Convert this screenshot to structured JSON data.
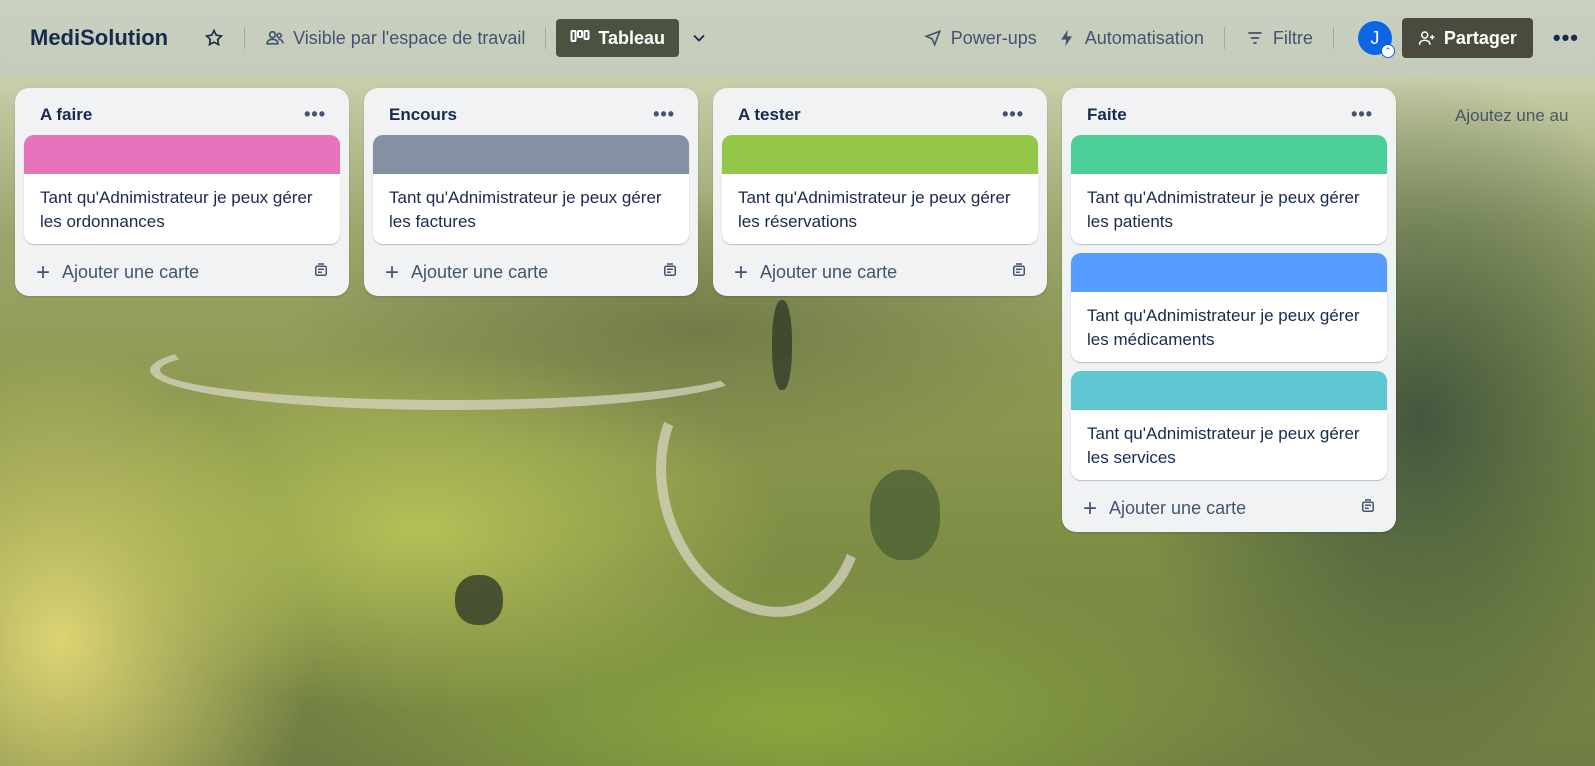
{
  "header": {
    "board_title": "MediSolution",
    "visibility_label": "Visible par l'espace de travail",
    "view_label": "Tableau",
    "powerups_label": "Power-ups",
    "automation_label": "Automatisation",
    "filter_label": "Filtre",
    "avatar_initial": "J",
    "share_label": "Partager",
    "more_label": "•••"
  },
  "lists": [
    {
      "title": "A faire",
      "menu": "•••",
      "add_card_label": "Ajouter une carte",
      "cards": [
        {
          "text": "Tant qu'Adnimistrateur je peux gérer les ordonnances",
          "cover_color": "#e774bb"
        }
      ]
    },
    {
      "title": "Encours",
      "menu": "•••",
      "add_card_label": "Ajouter une carte",
      "cards": [
        {
          "text": "Tant qu'Adnimistrateur je peux gérer les factures",
          "cover_color": "#8590a2"
        }
      ]
    },
    {
      "title": "A tester",
      "menu": "•••",
      "add_card_label": "Ajouter une carte",
      "cards": [
        {
          "text": "Tant qu'Adnimistrateur je peux gérer les réservations",
          "cover_color": "#94c748"
        }
      ]
    },
    {
      "title": "Faite",
      "menu": "•••",
      "add_card_label": "Ajouter une carte",
      "cards": [
        {
          "text": "Tant qu'Adnimistrateur je peux gérer les patients",
          "cover_color": "#4bce97"
        },
        {
          "text": "Tant qu'Adnimistrateur je peux gérer les médicaments",
          "cover_color": "#579dff"
        },
        {
          "text": "Tant qu'Adnimistrateur je peux gérer les services",
          "cover_color": "#60c6d2"
        }
      ]
    }
  ],
  "add_list_label": "Ajoutez une au"
}
